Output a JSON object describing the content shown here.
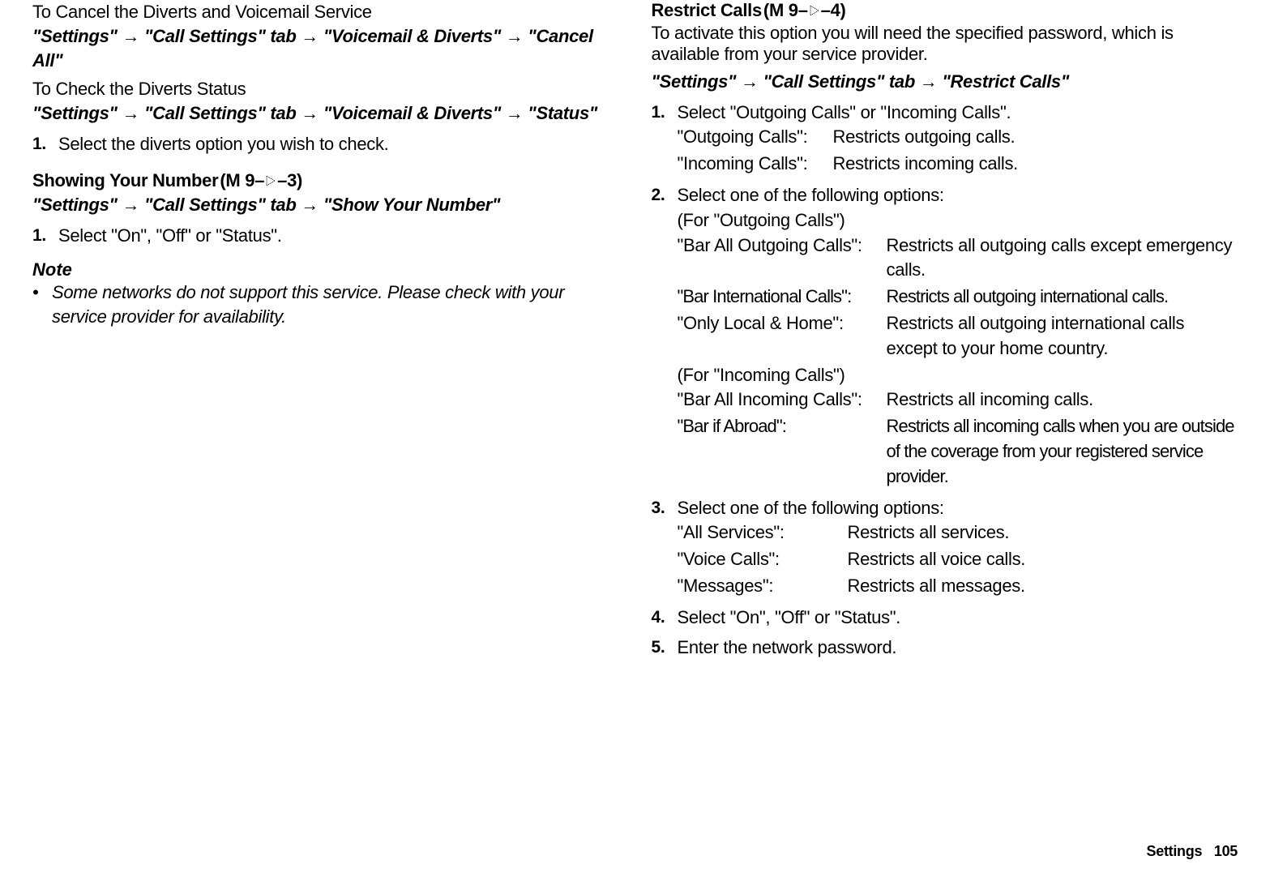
{
  "left": {
    "cancel_heading": "To Cancel the Diverts and Voicemail Service",
    "cancel_path": "\"Settings\" → \"Call Settings\" tab → \"Voicemail & Diverts\" → \"Cancel All\"",
    "status_heading": "To Check the Diverts Status",
    "status_path": "\"Settings\" → \"Call Settings\" tab → \"Voicemail & Diverts\" → \"Status\"",
    "status_step1": "Select the diverts option you wish to check.",
    "show_heading_pre": "Showing Your Number",
    "show_menu_prefix": "(M 9–",
    "show_menu_suffix": "–3)",
    "show_path": "\"Settings\" → \"Call Settings\" tab → \"Show Your Number\"",
    "show_step1": "Select \"On\", \"Off\" or \"Status\".",
    "note_label": "Note",
    "note_bullet": "•",
    "note_body": "Some networks do not support this service. Please check with your service provider for availability."
  },
  "right": {
    "restrict_heading_pre": "Restrict Calls",
    "restrict_menu_prefix": "(M 9–",
    "restrict_menu_suffix": "–4)",
    "restrict_intro": "To activate this option you will need the specified password, which is available from your service provider.",
    "restrict_path": "\"Settings\" → \"Call Settings\" tab → \"Restrict Calls\"",
    "step1": {
      "text": "Select \"Outgoing Calls\" or \"Incoming Calls\".",
      "rows": [
        {
          "label": "\"Outgoing Calls\":",
          "val": "Restricts outgoing calls."
        },
        {
          "label": "\"Incoming Calls\":",
          "val": "Restricts incoming calls."
        }
      ]
    },
    "step2": {
      "text": "Select one of the following options:",
      "out_label": "(For \"Outgoing Calls\")",
      "out_rows": [
        {
          "label": "\"Bar All Outgoing Calls\":",
          "val": "Restricts all outgoing calls except emergency calls."
        },
        {
          "label": "\"Bar International Calls\":",
          "val": "Restricts all outgoing international calls."
        },
        {
          "label": "\"Only Local & Home\":",
          "val": "Restricts all outgoing international calls except to your home country."
        }
      ],
      "in_label": "(For \"Incoming Calls\")",
      "in_rows": [
        {
          "label": "\"Bar All Incoming Calls\":",
          "val": "Restricts all incoming calls."
        },
        {
          "label": "\"Bar if Abroad\":",
          "val": "Restricts all incoming calls when you are outside of the coverage from your registered service provider."
        }
      ]
    },
    "step3": {
      "text": "Select one of the following options:",
      "rows": [
        {
          "label": "\"All Services\":",
          "val": "Restricts all services."
        },
        {
          "label": "\"Voice Calls\":",
          "val": "Restricts all voice calls."
        },
        {
          "label": "\"Messages\":",
          "val": "Restricts all messages."
        }
      ]
    },
    "step4": "Select \"On\", \"Off\" or \"Status\".",
    "step5": "Enter the network password."
  },
  "footer": {
    "section": "Settings",
    "page": "105"
  }
}
